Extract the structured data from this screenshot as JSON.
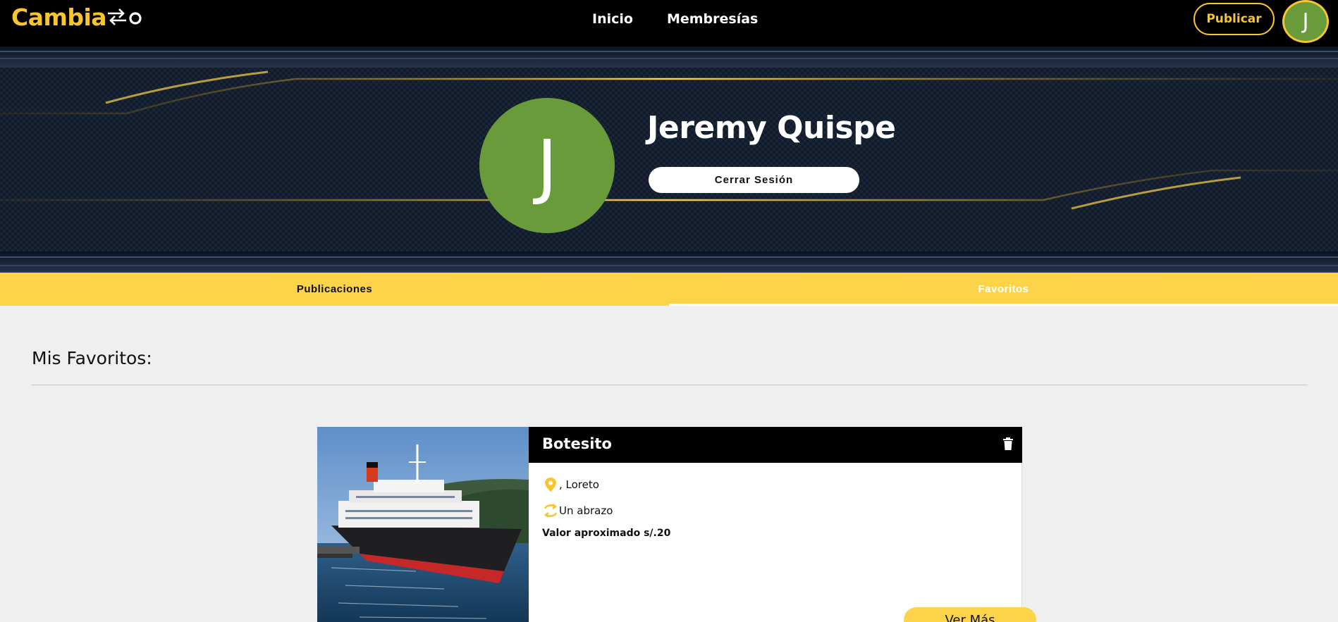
{
  "brand": {
    "name": "Cambiazo",
    "logo_text": "Cambia",
    "logo_suffix": "zo",
    "accent": "#f7c52f"
  },
  "nav": {
    "links": [
      {
        "label": "Inicio"
      },
      {
        "label": "Membresías"
      }
    ],
    "publish_label": "Publicar",
    "avatar_initial": "J"
  },
  "profile": {
    "initial": "J",
    "name": "Jeremy Quispe",
    "logout_label": "Cerrar Sesión",
    "avatar_color": "#6a9b3a"
  },
  "tabs": [
    {
      "label": "Publicaciones",
      "active": false
    },
    {
      "label": "Favoritos",
      "active": true
    }
  ],
  "favorites": {
    "title": "Mis Favoritos:",
    "items": [
      {
        "title": "Botesito",
        "location": ", Loreto",
        "exchange_for": "Un abrazo",
        "value_text": "Valor aproximado s/.20",
        "cta": "Ver Más",
        "image": "cruise-ship-photo"
      }
    ]
  },
  "colors": {
    "yellow": "#fdd34a",
    "navbar": "#000000",
    "page_bg": "#efefef"
  }
}
